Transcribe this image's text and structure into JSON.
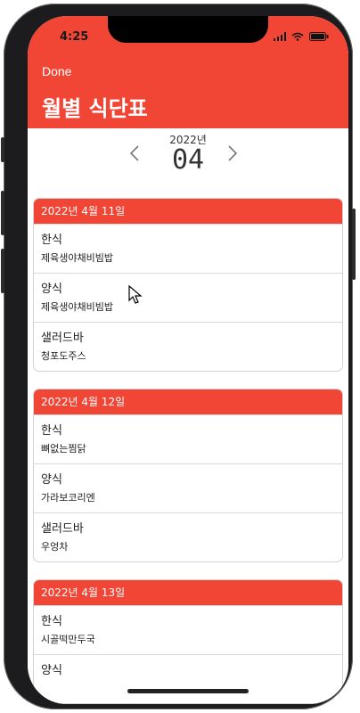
{
  "status_bar": {
    "time": "4:25"
  },
  "header": {
    "done_label": "Done",
    "title": "월별 식단표"
  },
  "month_picker": {
    "year": "2022년",
    "month": "04",
    "prev_icon": "chevron-left-icon",
    "next_icon": "chevron-right-icon"
  },
  "days": [
    {
      "date": "2022년 4월 11일",
      "meals": [
        {
          "category": "한식",
          "dish": "제육생야채비빔밥"
        },
        {
          "category": "양식",
          "dish": "제육생야채비빔밥"
        },
        {
          "category": "샐러드바",
          "dish": "청포도주스"
        }
      ]
    },
    {
      "date": "2022년 4월 12일",
      "meals": [
        {
          "category": "한식",
          "dish": "뼈없는찜닭"
        },
        {
          "category": "양식",
          "dish": "가라보코리엔"
        },
        {
          "category": "샐러드바",
          "dish": "우엉차"
        }
      ]
    },
    {
      "date": "2022년 4월 13일",
      "meals": [
        {
          "category": "한식",
          "dish": "시골떡만두국"
        },
        {
          "category": "양식",
          "dish": ""
        }
      ]
    }
  ],
  "colors": {
    "accent": "#f14636"
  }
}
